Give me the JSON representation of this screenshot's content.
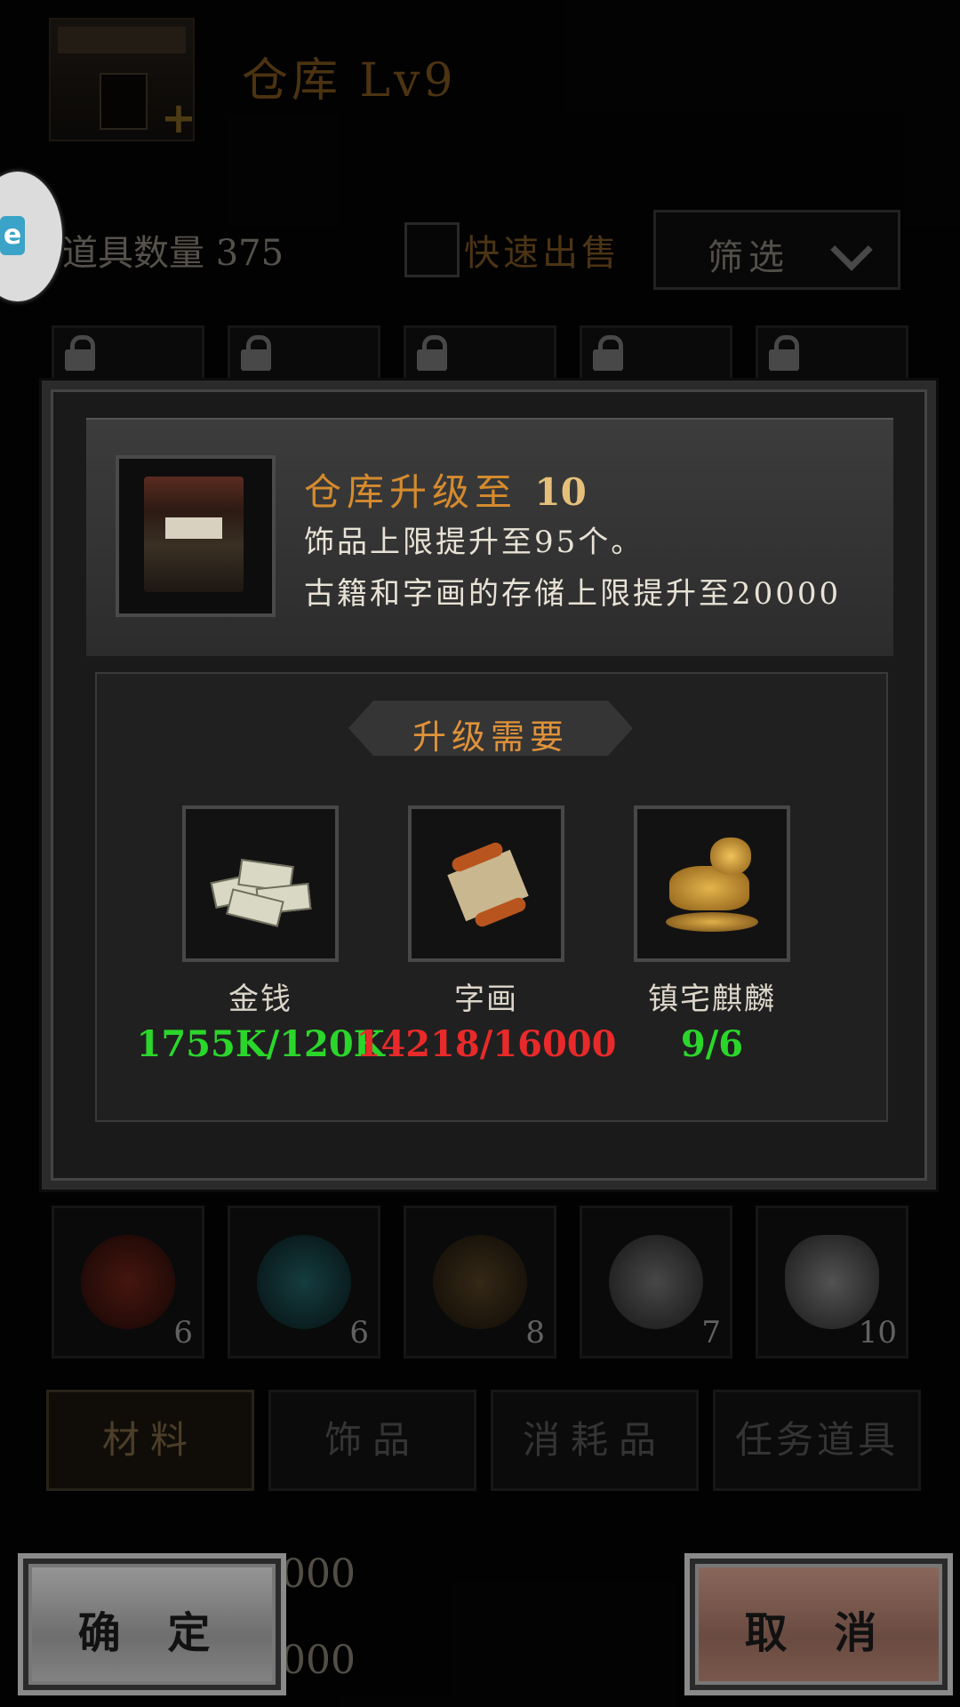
{
  "header": {
    "title": "仓库 Lv9"
  },
  "assist_button": {
    "logo_text": "e"
  },
  "toolbar": {
    "item_count_label": "道具数量 375",
    "quick_sell_label": "快速出售",
    "filter_label": "筛选"
  },
  "grid_top": [
    {
      "locked": true
    },
    {
      "locked": true
    },
    {
      "locked": true
    },
    {
      "locked": true
    },
    {
      "locked": true
    }
  ],
  "grid_bottom": [
    {
      "qty": "6"
    },
    {
      "qty": "6"
    },
    {
      "qty": "8"
    },
    {
      "qty": "7"
    },
    {
      "qty": "10"
    }
  ],
  "tabs": [
    "材料",
    "饰品",
    "消耗品",
    "任务道具"
  ],
  "background_values": [
    "000",
    "000"
  ],
  "modal": {
    "title_prefix": "仓库升级至",
    "target_level": "10",
    "desc_line1": "饰品上限提升至95个。",
    "desc_line2": "古籍和字画的存储上限提升至20000",
    "requirements_header": "升级需要",
    "requirements": [
      {
        "name": "金钱",
        "amount": "1755K/120K",
        "status": "met",
        "icon": "money-stack-icon"
      },
      {
        "name": "字画",
        "amount": "14218/16000",
        "status": "unmet",
        "icon": "scroll-painting-icon"
      },
      {
        "name": "镇宅麒麟",
        "amount": "9/6",
        "status": "met",
        "icon": "qilin-statue-icon"
      }
    ]
  },
  "buttons": {
    "confirm": "确 定",
    "cancel": "取 消"
  },
  "colors": {
    "met": "#2bd62b",
    "unmet": "#e82a2a",
    "accent": "#d58b2e"
  }
}
